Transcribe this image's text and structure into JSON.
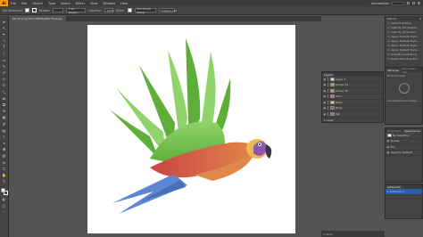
{
  "app": {
    "logo": "Ai"
  },
  "menu": [
    "File",
    "Edit",
    "Object",
    "Type",
    "Select",
    "Effect",
    "View",
    "Window",
    "Help"
  ],
  "workspace": "Automation",
  "control_bar": {
    "selection_label": "No Selection",
    "stroke_label": "Stroke:",
    "stroke_value": "",
    "brush_value": "5 pt. Round",
    "opacity_label": "Opacity:",
    "opacity_value": "100%",
    "style_label": "Style:",
    "doc_setup": "Document Setup",
    "preferences": "Preferences"
  },
  "document_tab": "Parrot.ai @ 50% (CMYK/GPU Preview)",
  "dock_right": {
    "title": "Actions",
    "rows": [
      "Default Actions",
      "Opacity 60 (selecti...",
      "Opacity 40 Screen...",
      "Apply Default Style...",
      "Apply Default Style...",
      "Apply Default Style...",
      "Apply Default Style...",
      "Simplify (selection)",
      "Reset Bounding Box"
    ]
  },
  "layers_panel": {
    "tab": "Layers",
    "rows": [
      {
        "name": "Layer 1",
        "color": "#4b76ff",
        "thumb": "#dddddd"
      },
      {
        "name": "Group 14",
        "color": "#4b76ff",
        "thumb": "#6cc24a"
      },
      {
        "name": "Group 15",
        "color": "#4b76ff",
        "thumb": "#6cc24a"
      },
      {
        "name": "Face",
        "color": "#4b76ff",
        "thumb": "#e06b5a"
      },
      {
        "name": "Beak",
        "color": "#4b76ff",
        "thumb": "#f0c060"
      },
      {
        "name": "Body",
        "color": "#4b76ff",
        "thumb": "#c24a4a"
      },
      {
        "name": "Tail",
        "color": "#4b76ff",
        "thumb": "#5b86d6"
      }
    ],
    "footer": "1 Layer"
  },
  "libraries_panel": {
    "tabs": [
      "Libraries",
      "Document Info"
    ],
    "drop_label": "Drop art here",
    "hint": "Use Libraries to share..."
  },
  "appearance_panel": {
    "tabs": [
      "Properties",
      "Appearance"
    ],
    "title": "No Selection",
    "stroke": "Stroke:",
    "fill": "Fill:",
    "opacity": "Opacity: Default"
  },
  "artboards_panel": {
    "tabs": [
      "Artboards"
    ],
    "row_index": "1",
    "row_name": "Artboard 1"
  },
  "colors": {
    "canvas": "#535353",
    "wing_light": "#8fd46a",
    "wing_dark": "#5fae3a",
    "body_red": "#c94444",
    "body_orange": "#e0884a",
    "tail_blue": "#5b86d6",
    "head_gold": "#f2b84f",
    "head_purple": "#8c5aa6"
  }
}
